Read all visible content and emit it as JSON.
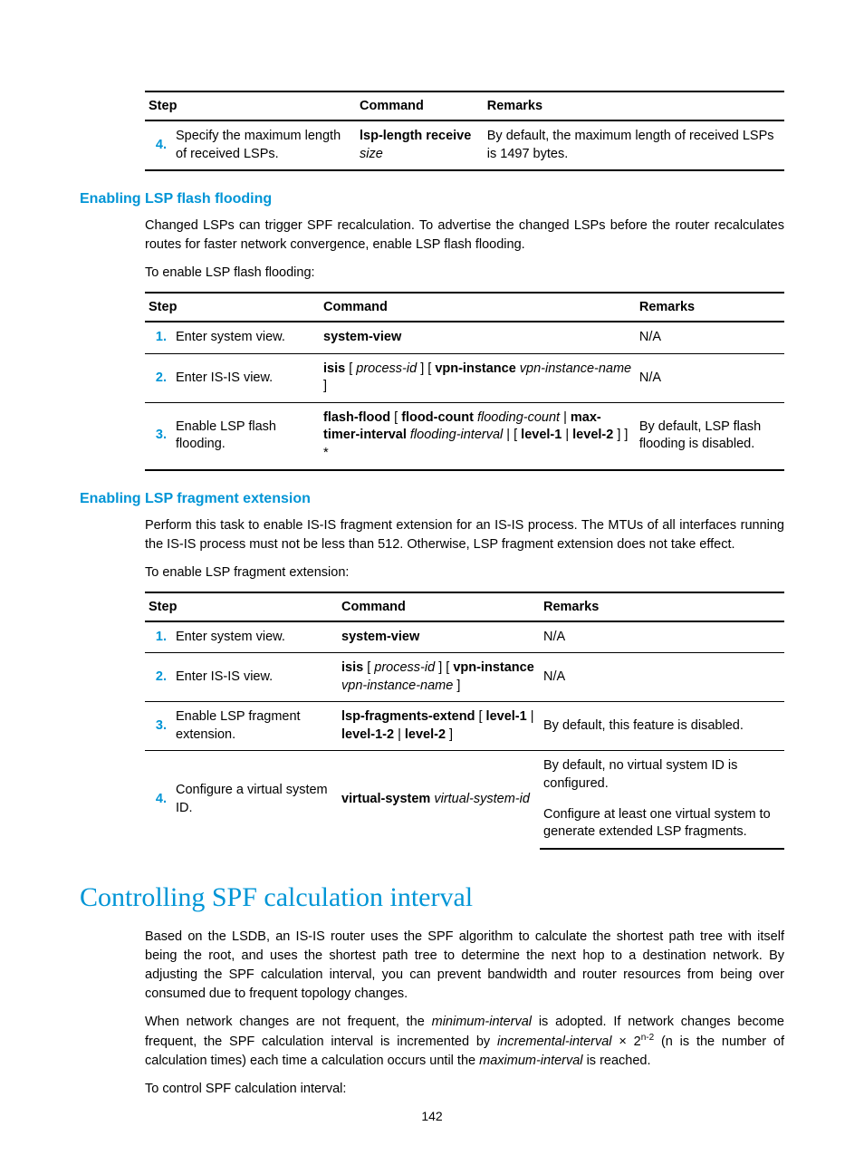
{
  "tbl1": {
    "h1": "Step",
    "h2": "Command",
    "h3": "Remarks",
    "r1": {
      "n": "4.",
      "step": "Specify the maximum length of received LSPs.",
      "cmd1": "lsp-length receive ",
      "cmd2": "size",
      "rem": "By default, the maximum length of received LSPs is 1497 bytes."
    }
  },
  "sec1": {
    "title": "Enabling LSP flash flooding",
    "p1": "Changed LSPs can trigger SPF recalculation. To advertise the changed LSPs before the router recalculates routes for faster network convergence, enable LSP flash flooding.",
    "p2": "To enable LSP flash flooding:"
  },
  "tbl2": {
    "h1": "Step",
    "h2": "Command",
    "h3": "Remarks",
    "r1": {
      "n": "1.",
      "step": "Enter system view.",
      "cmd": "system-view",
      "rem": "N/A"
    },
    "r2": {
      "n": "2.",
      "step": "Enter IS-IS view.",
      "c1": "isis",
      "c2": " [ ",
      "c3": "process-id",
      "c4": " ] [ ",
      "c5": "vpn-instance",
      "c6": " vpn-instance-name",
      "c7": " ]",
      "rem": "N/A"
    },
    "r3": {
      "n": "3.",
      "step": "Enable LSP flash flooding.",
      "c1": "flash-flood",
      "c2": " [ ",
      "c3": "flood-count",
      "c4": " flooding-count",
      "c5": " | ",
      "c6": "max-timer-interval",
      "c7": " flooding-interval",
      "c8": " | [ ",
      "c9": "level-1",
      "c10": " | ",
      "c11": "level-2",
      "c12": " ] ] *",
      "rem": "By default, LSP flash flooding is disabled."
    }
  },
  "sec2": {
    "title": "Enabling LSP fragment extension",
    "p1": "Perform this task to enable IS-IS fragment extension for an IS-IS process. The MTUs of all interfaces running the IS-IS process must not be less than 512. Otherwise, LSP fragment extension does not take effect.",
    "p2": "To enable LSP fragment extension:"
  },
  "tbl3": {
    "h1": "Step",
    "h2": "Command",
    "h3": "Remarks",
    "r1": {
      "n": "1.",
      "step": "Enter system view.",
      "cmd": "system-view",
      "rem": "N/A"
    },
    "r2": {
      "n": "2.",
      "step": "Enter IS-IS view.",
      "c1": "isis",
      "c2": " [ ",
      "c3": "process-id",
      "c4": " ] [ ",
      "c5": "vpn-instance",
      "c6": " vpn-instance-name",
      "c7": " ]",
      "rem": "N/A"
    },
    "r3": {
      "n": "3.",
      "step": "Enable LSP fragment extension.",
      "c1": "lsp-fragments-extend",
      "c2": " [ ",
      "c3": "level-1",
      "c4": " | ",
      "c5": "level-1-2",
      "c6": " | ",
      "c7": "level-2",
      "c8": " ]",
      "rem": "By default, this feature is disabled."
    },
    "r4": {
      "n": "4.",
      "step": "Configure a virtual system ID.",
      "c1": "virtual-system",
      "c2": " virtual-system-id",
      "rem1": "By default, no virtual system ID is configured.",
      "rem2": "Configure at least one virtual system to generate extended LSP fragments."
    }
  },
  "sec3": {
    "title": "Controlling SPF calculation interval",
    "p1": "Based on the LSDB, an IS-IS router uses the SPF algorithm to calculate the shortest path tree with itself being the root, and uses the shortest path tree to determine the next hop to a destination network. By adjusting the SPF calculation interval, you can prevent bandwidth and router resources from being over consumed due to frequent topology changes.",
    "p2a": "When network changes are not frequent, the ",
    "p2b": "minimum-interval",
    "p2c": " is adopted. If network changes become frequent, the SPF calculation interval is incremented by ",
    "p2d": "incremental-interval",
    "p2e": " × 2",
    "p2f": "n-2",
    "p2g": " (n is the number of calculation times) each time a calculation occurs until the ",
    "p2h": "maximum-interval",
    "p2i": " is reached.",
    "p3": "To control SPF calculation interval:"
  },
  "page": "142"
}
